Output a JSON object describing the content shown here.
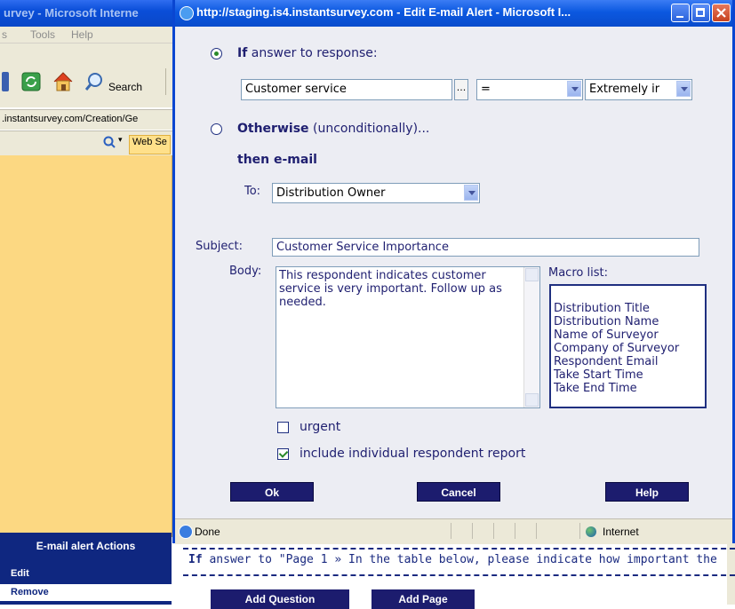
{
  "background_window": {
    "title": "urvey - Microsoft Interne",
    "menu": [
      "s",
      "Tools",
      "Help"
    ],
    "toolbar_search": "Search",
    "address": ".instantsurvey.com/Creation/Ge",
    "links_button": "Web Se",
    "actions_header": "E-mail alert Actions",
    "actions": [
      "Edit",
      "Remove"
    ],
    "condition_prefix": "If",
    "condition_text": " answer to \"Page 1 » In the table below, please indicate how important the",
    "buttons": [
      "Add Question",
      "Add Page"
    ]
  },
  "popup": {
    "title": "http://staging.is4.instantsurvey.com - Edit E-mail Alert - Microsoft I...",
    "if_bold": "If",
    "if_rest": " answer to response:",
    "response_value": "Customer service",
    "browse_label": "...",
    "operator_value": "=",
    "answer_value": "Extremely ir",
    "otherwise_bold": "Otherwise",
    "otherwise_rest": " (unconditionally)...",
    "then_email": "then e-mail",
    "to_label": "To:",
    "to_value": "Distribution Owner",
    "subject_label": "Subject:",
    "subject_value": "Customer Service Importance",
    "body_label": "Body:",
    "body_value": "This respondent indicates customer service is very important. Follow up as needed.",
    "macro_label": "Macro list:",
    "macros": [
      "Distribution Title",
      "Distribution Name",
      "Name of Surveyor",
      "Company of Surveyor",
      "Respondent Email",
      "Take Start Time",
      "Take End Time"
    ],
    "urgent_label": "urgent",
    "urgent_checked": false,
    "report_label": "include individual respondent report",
    "report_checked": true,
    "ok_label": "Ok",
    "cancel_label": "Cancel",
    "help_label": "Help",
    "status_text": "Done",
    "zone_text": "Internet",
    "selected_radio": "if"
  },
  "colors": {
    "title_blue": "#0a4ed8",
    "label_navy": "#1f1f70",
    "button_navy": "#1c1c6e",
    "left_panel": "#fcd882"
  }
}
